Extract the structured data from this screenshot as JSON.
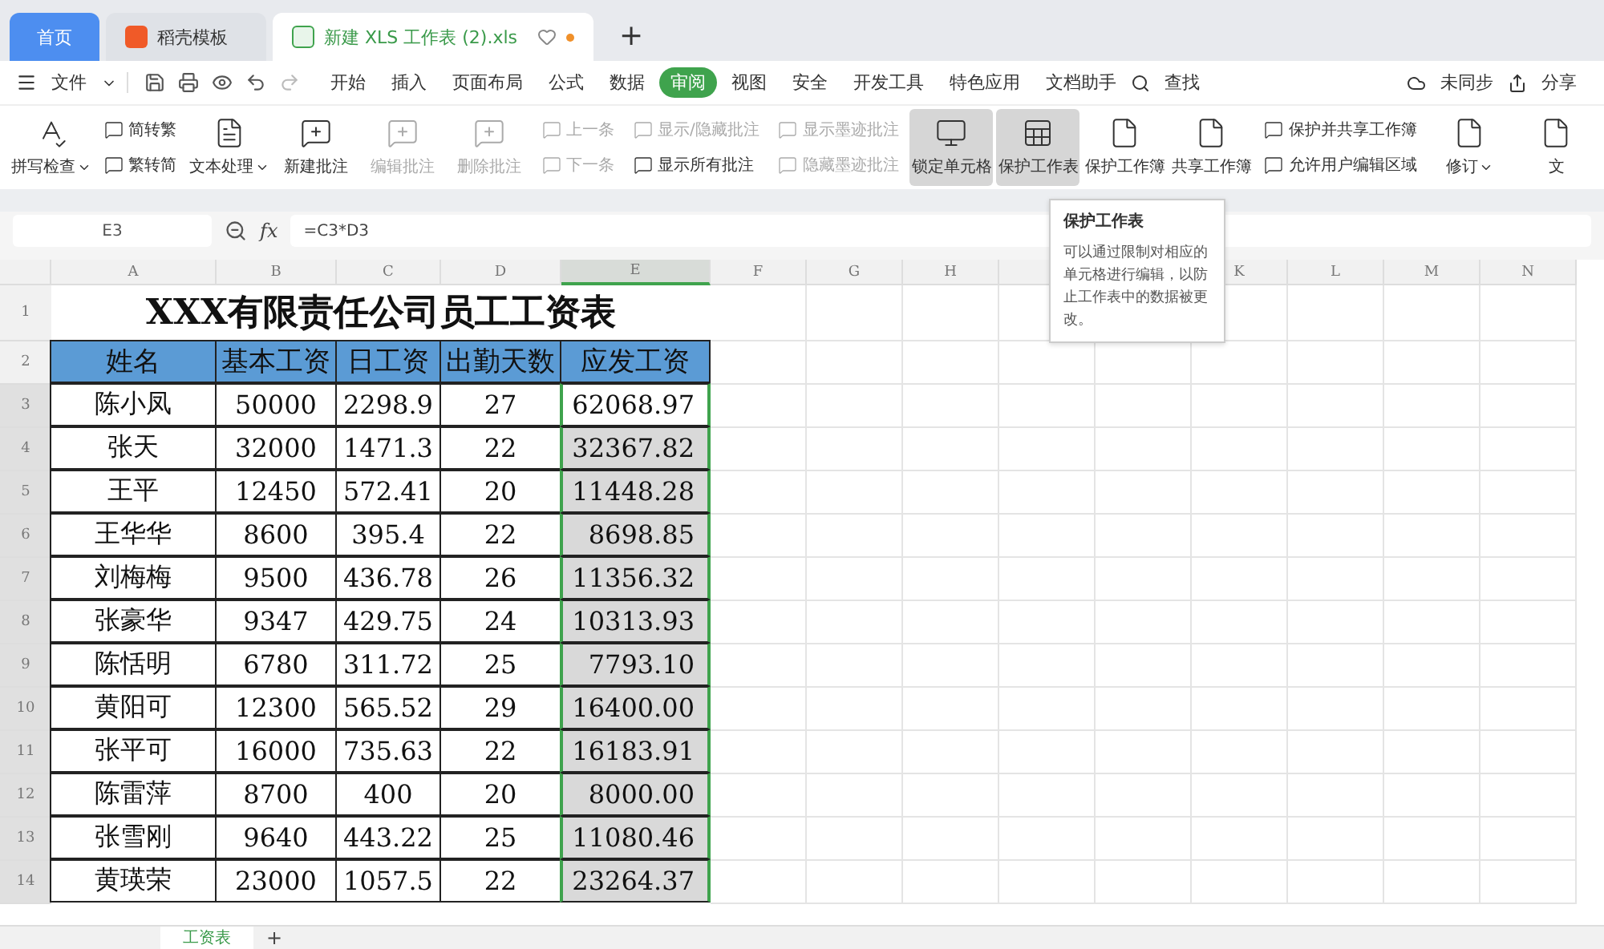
{
  "tabs": [
    {
      "label": "首页",
      "kind": "home",
      "selected": false
    },
    {
      "label": "稻壳模板",
      "kind": "template",
      "selected": false
    },
    {
      "label": "新建 XLS 工作表 (2).xls",
      "kind": "document",
      "selected": true
    }
  ],
  "add_tab": "+",
  "menu": {
    "file": "文件",
    "items": [
      {
        "label": "开始",
        "selected": false
      },
      {
        "label": "插入",
        "selected": false
      },
      {
        "label": "页面布局",
        "selected": false
      },
      {
        "label": "公式",
        "selected": false
      },
      {
        "label": "数据",
        "selected": false
      },
      {
        "label": "审阅",
        "selected": true
      },
      {
        "label": "视图",
        "selected": false
      },
      {
        "label": "安全",
        "selected": false
      },
      {
        "label": "开发工具",
        "selected": false
      },
      {
        "label": "特色应用",
        "selected": false
      },
      {
        "label": "文档助手",
        "selected": false
      }
    ],
    "search": "查找",
    "sync": "未同步",
    "share": "分享"
  },
  "ribbon": [
    {
      "kind": "large",
      "label": "拼写检查",
      "dropdown": true,
      "pressed": false,
      "disabled": false
    },
    {
      "kind": "stack",
      "items": [
        {
          "label": "简转繁",
          "disabled": false
        },
        {
          "label": "繁转简",
          "disabled": false
        }
      ]
    },
    {
      "kind": "large",
      "label": "文本处理",
      "dropdown": true,
      "pressed": false,
      "disabled": false
    },
    {
      "kind": "large",
      "label": "新建批注",
      "dropdown": false,
      "pressed": false,
      "disabled": false
    },
    {
      "kind": "large",
      "label": "编辑批注",
      "dropdown": false,
      "pressed": false,
      "disabled": true
    },
    {
      "kind": "large",
      "label": "删除批注",
      "dropdown": false,
      "pressed": false,
      "disabled": true
    },
    {
      "kind": "stack",
      "items": [
        {
          "label": "上一条",
          "disabled": true
        },
        {
          "label": "下一条",
          "disabled": true
        }
      ]
    },
    {
      "kind": "stack",
      "items": [
        {
          "label": "显示/隐藏批注",
          "disabled": true
        },
        {
          "label": "显示所有批注",
          "disabled": false
        }
      ]
    },
    {
      "kind": "stack",
      "items": [
        {
          "label": "显示墨迹批注",
          "disabled": true
        },
        {
          "label": "隐藏墨迹批注",
          "disabled": true
        }
      ]
    },
    {
      "kind": "large",
      "label": "锁定单元格",
      "dropdown": false,
      "pressed": true,
      "disabled": false
    },
    {
      "kind": "large",
      "label": "保护工作表",
      "dropdown": false,
      "pressed": true,
      "disabled": false
    },
    {
      "kind": "large",
      "label": "保护工作簿",
      "dropdown": false,
      "pressed": false,
      "disabled": false
    },
    {
      "kind": "large",
      "label": "共享工作簿",
      "dropdown": false,
      "pressed": false,
      "disabled": false
    },
    {
      "kind": "stack",
      "items": [
        {
          "label": "保护并共享工作簿",
          "disabled": false
        },
        {
          "label": "允许用户编辑区域",
          "disabled": false
        }
      ]
    },
    {
      "kind": "large",
      "label": "修订",
      "dropdown": true,
      "pressed": false,
      "disabled": false
    },
    {
      "kind": "large",
      "label": "文",
      "dropdown": false,
      "pressed": false,
      "disabled": false
    }
  ],
  "name_box": "E3",
  "formula_label": "fx",
  "formula": "=C3*D3",
  "columns": [
    {
      "label": "A",
      "selected": false
    },
    {
      "label": "B",
      "selected": false
    },
    {
      "label": "C",
      "selected": false
    },
    {
      "label": "D",
      "selected": false
    },
    {
      "label": "E",
      "selected": true
    },
    {
      "label": "F",
      "selected": false
    },
    {
      "label": "G",
      "selected": false
    },
    {
      "label": "H",
      "selected": false
    },
    {},
    {},
    {
      "label": "K",
      "selected": false
    },
    {
      "label": "L",
      "selected": false
    },
    {
      "label": "M",
      "selected": false
    },
    {
      "label": "N",
      "selected": false
    }
  ],
  "sheet": {
    "title_row": "1",
    "title": "XXX有限责任公司员工工资表",
    "header_row": "2",
    "header": [
      "姓名",
      "基本工资",
      "日工资",
      "出勤天数",
      "应发工资"
    ],
    "rows": [
      {
        "number": "3",
        "cells": [
          "陈小凤",
          "50000",
          "2298.9",
          "27",
          "62068.97"
        ],
        "selected": true,
        "active": true
      },
      {
        "number": "4",
        "cells": [
          "张天",
          "32000",
          "1471.3",
          "22",
          "32367.82"
        ],
        "selected": true,
        "active": false
      },
      {
        "number": "5",
        "cells": [
          "王平",
          "12450",
          "572.41",
          "20",
          "11448.28"
        ],
        "selected": true,
        "active": false
      },
      {
        "number": "6",
        "cells": [
          "王华华",
          "8600",
          "395.4",
          "22",
          "8698.85"
        ],
        "selected": true,
        "active": false
      },
      {
        "number": "7",
        "cells": [
          "刘梅梅",
          "9500",
          "436.78",
          "26",
          "11356.32"
        ],
        "selected": true,
        "active": false
      },
      {
        "number": "8",
        "cells": [
          "张豪华",
          "9347",
          "429.75",
          "24",
          "10313.93"
        ],
        "selected": true,
        "active": false
      },
      {
        "number": "9",
        "cells": [
          "陈恬明",
          "6780",
          "311.72",
          "25",
          "7793.10"
        ],
        "selected": true,
        "active": false
      },
      {
        "number": "10",
        "cells": [
          "黄阳可",
          "12300",
          "565.52",
          "29",
          "16400.00"
        ],
        "selected": true,
        "active": false
      },
      {
        "number": "11",
        "cells": [
          "张平可",
          "16000",
          "735.63",
          "22",
          "16183.91"
        ],
        "selected": true,
        "active": false
      },
      {
        "number": "12",
        "cells": [
          "陈雷萍",
          "8700",
          "400",
          "20",
          "8000.00"
        ],
        "selected": true,
        "active": false
      },
      {
        "number": "13",
        "cells": [
          "张雪刚",
          "9640",
          "443.22",
          "25",
          "11080.46"
        ],
        "selected": true,
        "active": false
      },
      {
        "number": "14",
        "cells": [
          "黄瑛荣",
          "23000",
          "1057.5",
          "22",
          "23264.37"
        ],
        "selected": true,
        "active": false
      }
    ]
  },
  "tooltip": {
    "title": "保护工作表",
    "text": "可以通过限制对相应的单元格进行编辑，以防止工作表中的数据被更改。"
  },
  "sheet_tabs": [
    {
      "label": "工资表",
      "selected": true
    }
  ],
  "add_sheet": "+"
}
